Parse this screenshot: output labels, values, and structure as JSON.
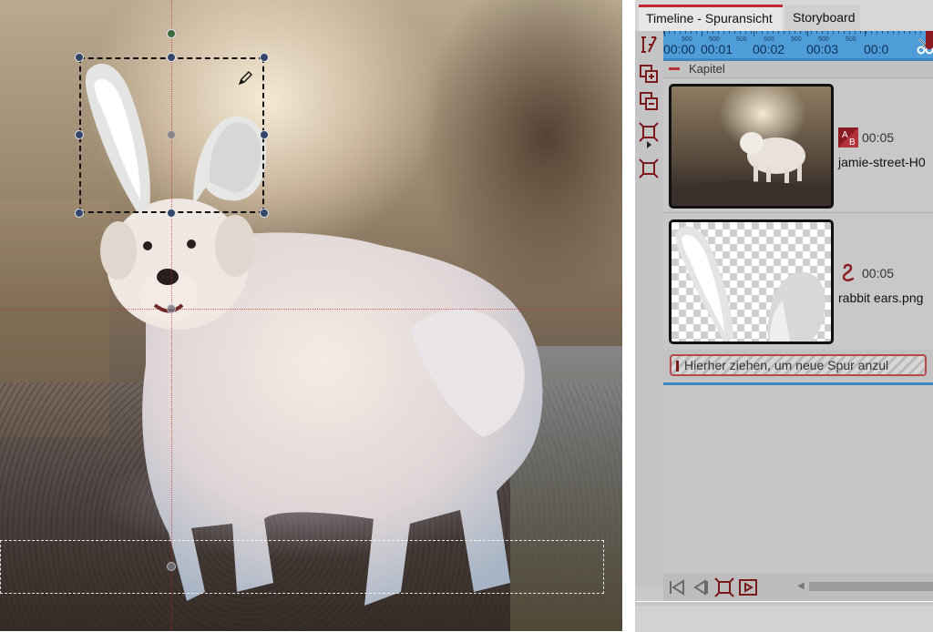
{
  "timeline": {
    "tabs": [
      {
        "label": "Timeline - Spuransicht",
        "active": true
      },
      {
        "label": "Storyboard",
        "active": false
      }
    ],
    "ruler": {
      "small_ticks": [
        "500",
        "500",
        "500",
        "500",
        "500",
        "500",
        "500"
      ],
      "labels": [
        "00:00",
        "00:01",
        "00:02",
        "00:03",
        "00:0"
      ]
    },
    "chapter_label": "Kapitel",
    "clips": [
      {
        "duration": "00:05",
        "name": "jamie-street-H0",
        "effect_icon": "ab-transition-icon"
      },
      {
        "duration": "00:05",
        "name": "rabbit ears.png",
        "effect_icon": "curve-path-icon"
      }
    ],
    "new_track_hint": "Hierher ziehen, um neue Spur anzul"
  },
  "colors": {
    "accent_red": "#c0282d",
    "ruler_blue": "#4f9dd8",
    "selection_handle": "#34456a"
  },
  "preview": {
    "subject": "dog-with-rabbit-ears"
  }
}
